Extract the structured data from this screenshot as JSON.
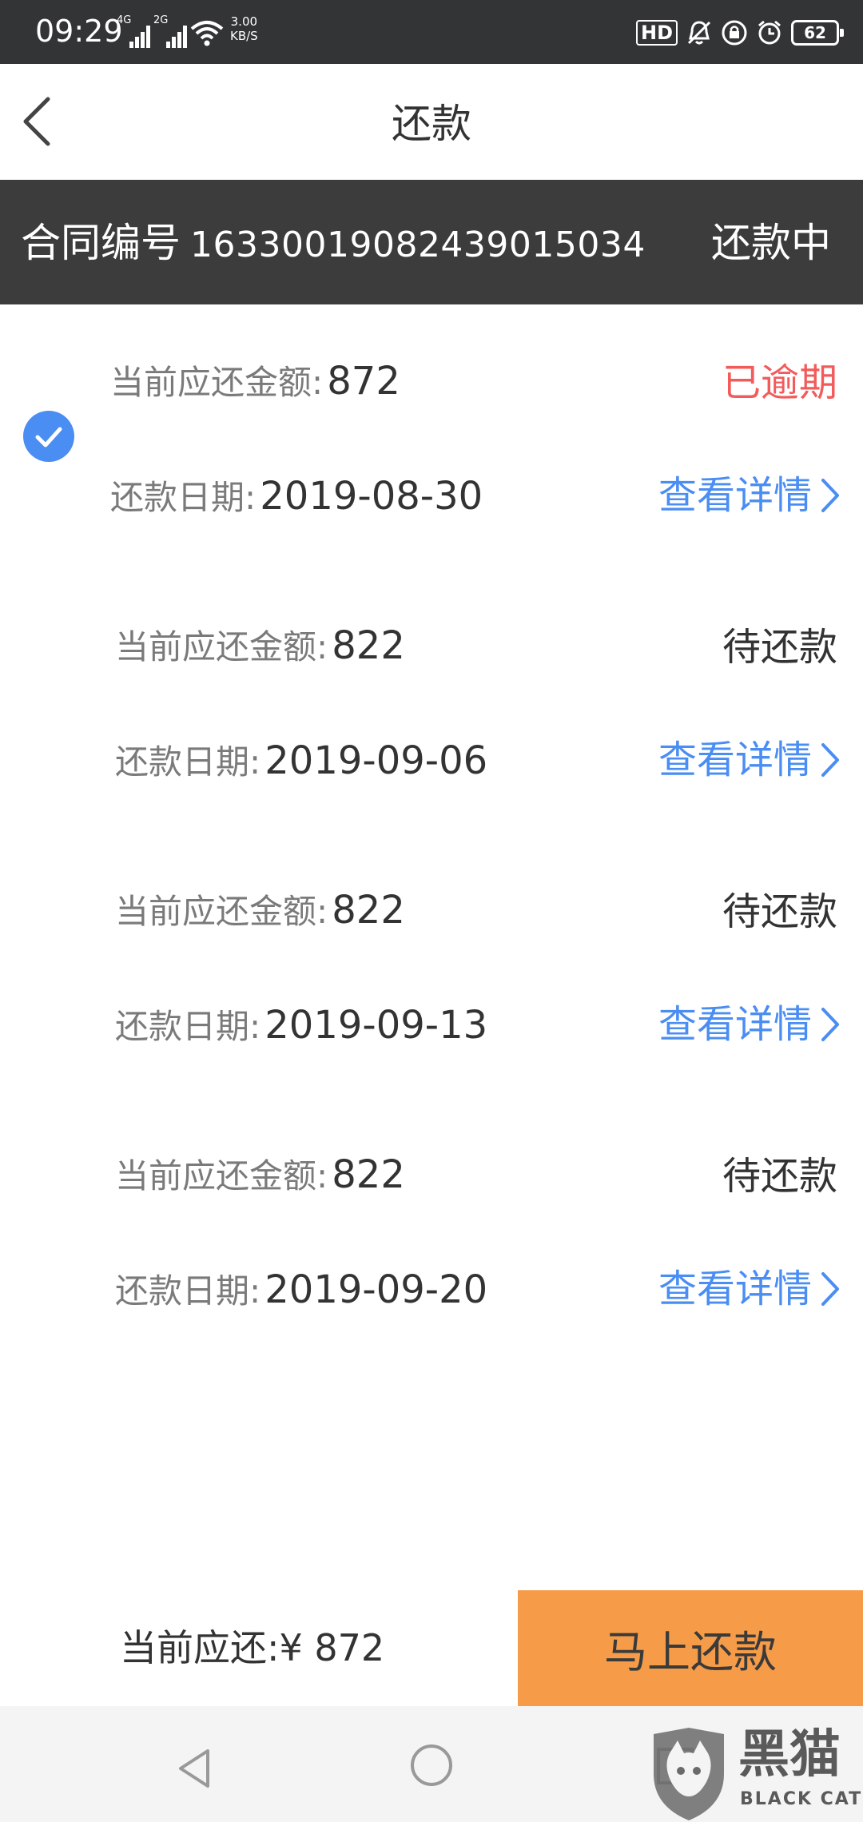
{
  "status_bar": {
    "time": "09:29",
    "signal_1": "4G",
    "signal_2": "2G",
    "speed_value": "3.00",
    "speed_unit": "KB/S",
    "hd_label": "HD",
    "battery": "62"
  },
  "header": {
    "title": "还款",
    "back_icon": "chevron-left-icon"
  },
  "contract": {
    "label": "合同编号",
    "number": "16330019082439015034",
    "status": "还款中"
  },
  "items": [
    {
      "amount_label": "当前应还金额:",
      "amount": "872",
      "status": "已逾期",
      "status_color": "#f35b5b",
      "date_label": "还款日期:",
      "date": "2019-08-30",
      "detail": "查看详情",
      "selected": true
    },
    {
      "amount_label": "当前应还金额:",
      "amount": "822",
      "status": "待还款",
      "status_color": "#333333",
      "date_label": "还款日期:",
      "date": "2019-09-06",
      "detail": "查看详情",
      "selected": false
    },
    {
      "amount_label": "当前应还金额:",
      "amount": "822",
      "status": "待还款",
      "status_color": "#333333",
      "date_label": "还款日期:",
      "date": "2019-09-13",
      "detail": "查看详情",
      "selected": false
    },
    {
      "amount_label": "当前应还金额:",
      "amount": "822",
      "status": "待还款",
      "status_color": "#333333",
      "date_label": "还款日期:",
      "date": "2019-09-20",
      "detail": "查看详情",
      "selected": false
    }
  ],
  "footer": {
    "total_label": "当前应还:",
    "total_value": "¥ 872",
    "pay_button": "马上还款"
  },
  "colors": {
    "accent_blue": "#4a8df3",
    "overdue_red": "#f35b5b",
    "pay_orange": "#f69c48"
  },
  "watermark": {
    "text": "黑猫",
    "subtext": "BLACK CAT"
  }
}
